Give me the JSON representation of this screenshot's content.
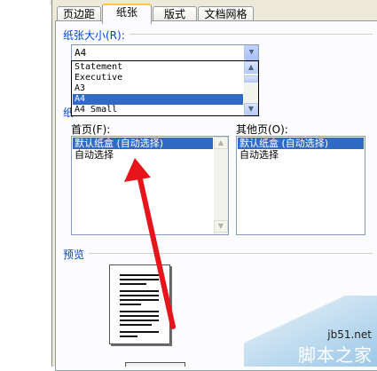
{
  "tabs": [
    {
      "label": "页边距"
    },
    {
      "label": "纸张"
    },
    {
      "label": "版式"
    },
    {
      "label": "文档网格"
    }
  ],
  "active_tab": "纸张",
  "paper_size": {
    "label": "纸张大小(R):",
    "value": "A4",
    "options": [
      "Statement",
      "Executive",
      "A3",
      "A4",
      "A4 Small"
    ],
    "selected": "A4"
  },
  "paper_source": {
    "section_label_partial": "纸",
    "first_page": {
      "label": "首页(F):",
      "items": [
        "默认纸盒 (自动选择)",
        "自动选择"
      ],
      "selected": "默认纸盒 (自动选择)"
    },
    "other_pages": {
      "label": "其他页(O):",
      "items": [
        "默认纸盒 (自动选择)",
        "自动选择"
      ],
      "selected": "默认纸盒 (自动选择)"
    }
  },
  "preview": {
    "label": "预览"
  },
  "annotation": {
    "arrow_color": "#e8141b"
  },
  "watermark": {
    "site": "jb51.net",
    "name": "脚本之家"
  },
  "colors": {
    "selection": "#316ac5",
    "label_blue": "#0046d5",
    "tab_highlight": "#ffc83c"
  }
}
